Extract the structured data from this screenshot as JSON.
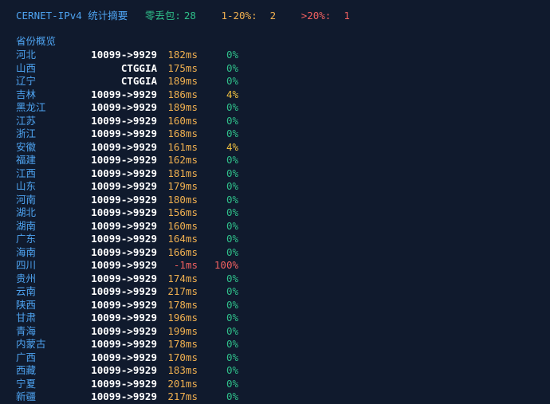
{
  "summary": {
    "title": "CERNET-IPv4 统计摘要",
    "zero_loss_label": "零丢包:",
    "zero_loss_count": "28",
    "low_loss_label": "1-20%:",
    "low_loss_count": "2",
    "high_loss_label": ">20%:",
    "high_loss_count": "1"
  },
  "section_title": "省份概览",
  "rows": [
    {
      "province": "河北",
      "route": "10099->9929",
      "latency": "182ms",
      "loss": "0%"
    },
    {
      "province": "山西",
      "route": "CTGGIA",
      "latency": "175ms",
      "loss": "0%"
    },
    {
      "province": "辽宁",
      "route": "CTGGIA",
      "latency": "189ms",
      "loss": "0%"
    },
    {
      "province": "吉林",
      "route": "10099->9929",
      "latency": "186ms",
      "loss": "4%"
    },
    {
      "province": "黑龙江",
      "route": "10099->9929",
      "latency": "189ms",
      "loss": "0%"
    },
    {
      "province": "江苏",
      "route": "10099->9929",
      "latency": "160ms",
      "loss": "0%"
    },
    {
      "province": "浙江",
      "route": "10099->9929",
      "latency": "168ms",
      "loss": "0%"
    },
    {
      "province": "安徽",
      "route": "10099->9929",
      "latency": "161ms",
      "loss": "4%"
    },
    {
      "province": "福建",
      "route": "10099->9929",
      "latency": "162ms",
      "loss": "0%"
    },
    {
      "province": "江西",
      "route": "10099->9929",
      "latency": "181ms",
      "loss": "0%"
    },
    {
      "province": "山东",
      "route": "10099->9929",
      "latency": "179ms",
      "loss": "0%"
    },
    {
      "province": "河南",
      "route": "10099->9929",
      "latency": "180ms",
      "loss": "0%"
    },
    {
      "province": "湖北",
      "route": "10099->9929",
      "latency": "156ms",
      "loss": "0%"
    },
    {
      "province": "湖南",
      "route": "10099->9929",
      "latency": "160ms",
      "loss": "0%"
    },
    {
      "province": "广东",
      "route": "10099->9929",
      "latency": "164ms",
      "loss": "0%"
    },
    {
      "province": "海南",
      "route": "10099->9929",
      "latency": "166ms",
      "loss": "0%"
    },
    {
      "province": "四川",
      "route": "10099->9929",
      "latency": "-1ms",
      "loss": "100%"
    },
    {
      "province": "贵州",
      "route": "10099->9929",
      "latency": "174ms",
      "loss": "0%"
    },
    {
      "province": "云南",
      "route": "10099->9929",
      "latency": "217ms",
      "loss": "0%"
    },
    {
      "province": "陕西",
      "route": "10099->9929",
      "latency": "178ms",
      "loss": "0%"
    },
    {
      "province": "甘肃",
      "route": "10099->9929",
      "latency": "196ms",
      "loss": "0%"
    },
    {
      "province": "青海",
      "route": "10099->9929",
      "latency": "199ms",
      "loss": "0%"
    },
    {
      "province": "内蒙古",
      "route": "10099->9929",
      "latency": "178ms",
      "loss": "0%"
    },
    {
      "province": "广西",
      "route": "10099->9929",
      "latency": "170ms",
      "loss": "0%"
    },
    {
      "province": "西藏",
      "route": "10099->9929",
      "latency": "183ms",
      "loss": "0%"
    },
    {
      "province": "宁夏",
      "route": "10099->9929",
      "latency": "201ms",
      "loss": "0%"
    },
    {
      "province": "新疆",
      "route": "10099->9929",
      "latency": "217ms",
      "loss": "0%"
    }
  ],
  "colors": {
    "background": "#101a2d",
    "province": "#4ea3f0",
    "latency": "#f0b050",
    "loss_ok": "#2fbf8a",
    "loss_warn": "#f0c040",
    "loss_bad": "#f06060"
  }
}
